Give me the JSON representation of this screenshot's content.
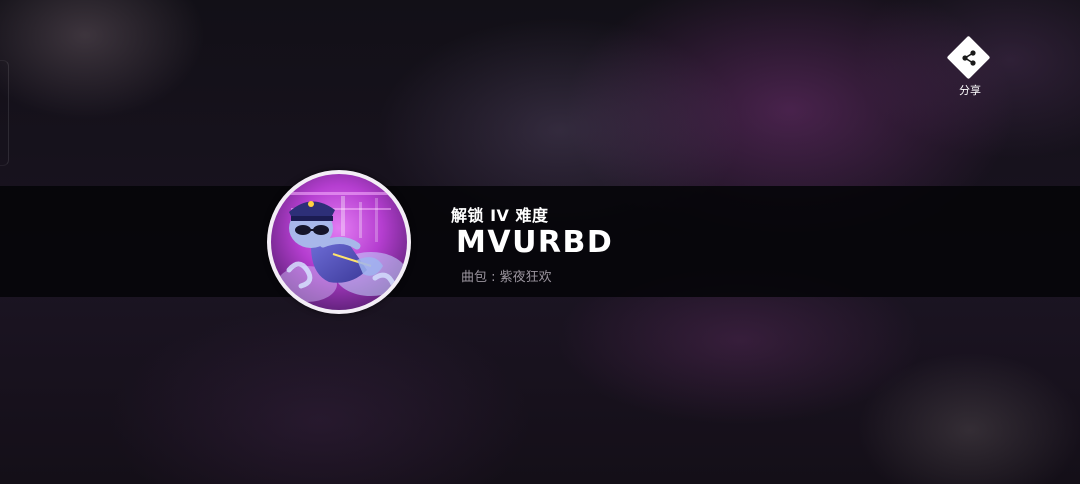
{
  "unlock": {
    "text": "解锁 IV 难度"
  },
  "song": {
    "title": "MVURBD",
    "pack_label": "曲包 : 紫夜狂欢"
  },
  "share": {
    "label": "分享",
    "icon": "share-icon"
  },
  "cover": {
    "icon": "song-cover-art"
  },
  "colors": {
    "banner": "#050508",
    "text_primary": "#ffffff",
    "text_secondary": "#9a949e",
    "cover_accent": "#c23fd6",
    "ring": "#f3eef6"
  }
}
